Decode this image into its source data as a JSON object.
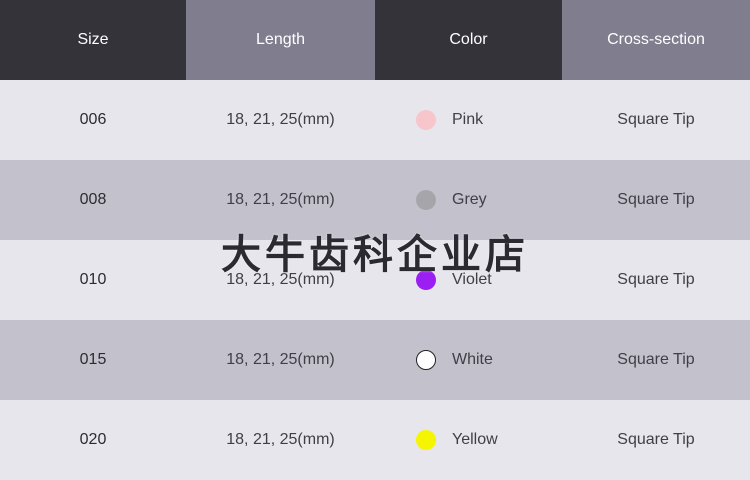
{
  "header": {
    "size": "Size",
    "length": "Length",
    "color": "Color",
    "cross_section": "Cross-section"
  },
  "rows": [
    {
      "size": "006",
      "length": "18, 21, 25(mm)",
      "color": "Pink",
      "swatch": "#f7c6cc",
      "cross_section": "Square Tip"
    },
    {
      "size": "008",
      "length": "18, 21, 25(mm)",
      "color": "Grey",
      "swatch": "#a6a6aa",
      "cross_section": "Square Tip"
    },
    {
      "size": "010",
      "length": "18, 21, 25(mm)",
      "color": "Violet",
      "swatch": "#9b1ff2",
      "cross_section": "Square Tip"
    },
    {
      "size": "015",
      "length": "18, 21, 25(mm)",
      "color": "White",
      "swatch": "#ffffff",
      "cross_section": "Square Tip"
    },
    {
      "size": "020",
      "length": "18, 21, 25(mm)",
      "color": "Yellow",
      "swatch": "#f5f500",
      "cross_section": "Square Tip"
    }
  ],
  "watermark": "大牛齿科企业店"
}
